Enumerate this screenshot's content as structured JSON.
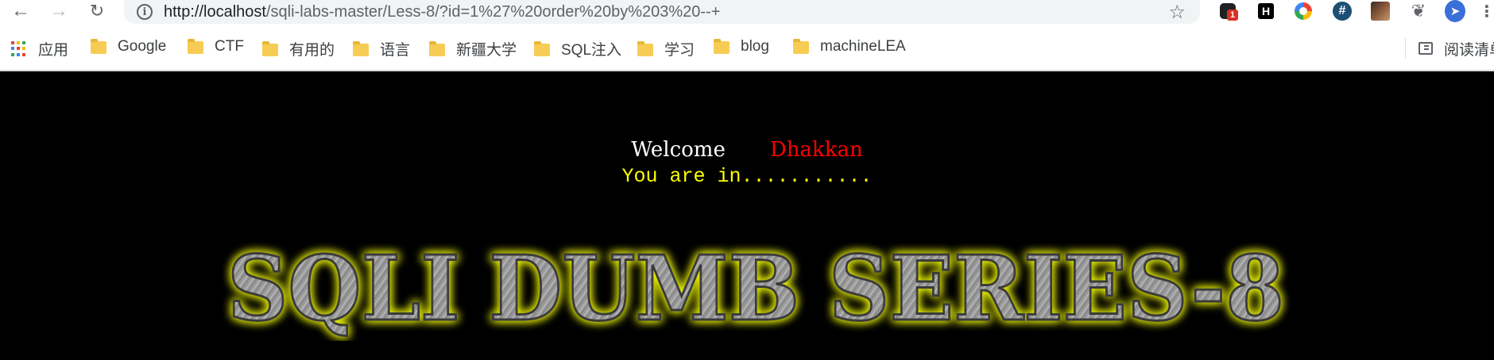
{
  "browser": {
    "url_scheme_host": "http://localhost",
    "url_path": "/sqli-labs-master/Less-8/?id=1%27%20order%20by%203%20--+",
    "extension_badge": "1",
    "extension_h_letter": "H",
    "extension_hash_symbol": "#"
  },
  "bookmarks": {
    "apps_label": "应用",
    "items": [
      {
        "label": "Google"
      },
      {
        "label": "CTF"
      },
      {
        "label": "有用的"
      },
      {
        "label": "语言"
      },
      {
        "label": "新疆大学"
      },
      {
        "label": "SQL注入"
      },
      {
        "label": "学习"
      },
      {
        "label": "blog"
      },
      {
        "label": "machineLEA"
      }
    ],
    "reading_list_label": "阅读清单"
  },
  "page": {
    "welcome": "Welcome",
    "user": "Dhakkan",
    "status": "You are in...........",
    "banner_text": "SQLI DUMB SERIES-8"
  },
  "colors": {
    "page_background": "#000000",
    "welcome_text": "#ffffff",
    "user_text": "#ff0000",
    "status_text": "#ffff00",
    "banner_glow": "#e8f000"
  }
}
